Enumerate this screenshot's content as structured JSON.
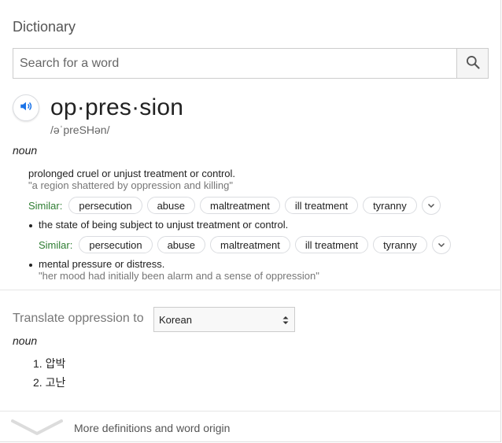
{
  "header": {
    "title": "Dictionary"
  },
  "search": {
    "placeholder": "Search for a word"
  },
  "entry": {
    "word": "op·pres·sion",
    "phonetic": "/əˈpreSHən/",
    "part_of_speech": "noun",
    "senses": [
      {
        "definition": "prolonged cruel or unjust treatment or control.",
        "example": "\"a region shattered by oppression and killing\"",
        "similar_label": "Similar:",
        "similar": [
          "persecution",
          "abuse",
          "maltreatment",
          "ill treatment",
          "tyranny"
        ]
      },
      {
        "definition": "the state of being subject to unjust treatment or control.",
        "similar_label": "Similar:",
        "similar": [
          "persecution",
          "abuse",
          "maltreatment",
          "ill treatment",
          "tyranny"
        ]
      },
      {
        "definition": "mental pressure or distress.",
        "example": "\"her mood had initially been alarm and a sense of oppression\""
      }
    ]
  },
  "translate": {
    "label": "Translate oppression to",
    "selected_language": "Korean",
    "part_of_speech": "noun",
    "items": [
      "1. 압박",
      "2. 고난"
    ]
  },
  "footer": {
    "more_label": "More definitions and word origin"
  },
  "icons": {
    "search": "search-icon",
    "speaker": "speaker-icon",
    "expand": "chevron-down-icon",
    "select_arrows": "select-arrows-icon",
    "more": "chevron-down-icon"
  },
  "colors": {
    "similar_label": "#2e7d32",
    "speaker_blue": "#1a73e8"
  }
}
